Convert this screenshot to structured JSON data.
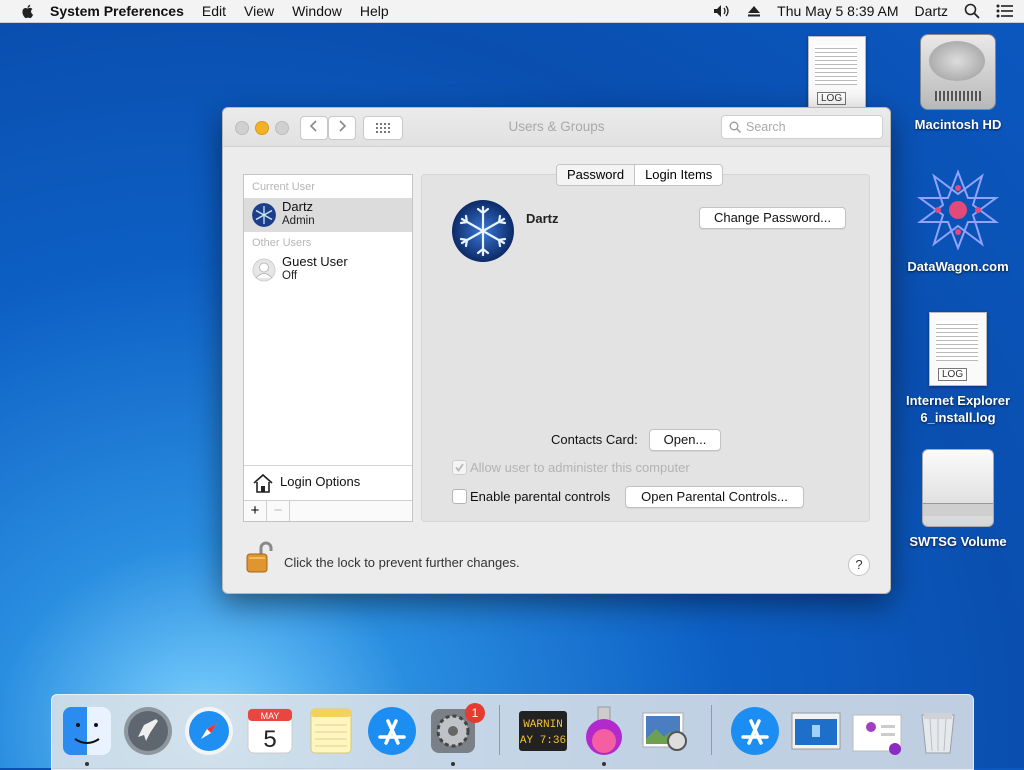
{
  "menubar": {
    "app_name": "System Preferences",
    "items": [
      "Edit",
      "View",
      "Window",
      "Help"
    ],
    "clock": "Thu May 5  8:39 AM",
    "user": "Dartz"
  },
  "desktop": {
    "icons": [
      {
        "label": "Macintosh HD"
      },
      {
        "label": "DataWagon.com"
      },
      {
        "label": "Internet Explorer 6_install.log"
      },
      {
        "label": "SWTSG Volume"
      }
    ],
    "log_tag": "LOG"
  },
  "window": {
    "title": "Users & Groups",
    "search_placeholder": "Search",
    "user_list": {
      "current_user_header": "Current User",
      "current_user": {
        "name": "Dartz",
        "role": "Admin"
      },
      "other_users_header": "Other Users",
      "other_users": [
        {
          "name": "Guest User",
          "status": "Off"
        }
      ],
      "login_options": "Login Options",
      "add_label": "+",
      "remove_label": "−"
    },
    "tabs": [
      "Password",
      "Login Items"
    ],
    "selected_tab": "Password",
    "user_name": "Dartz",
    "change_password": "Change Password...",
    "contacts_card_label": "Contacts Card:",
    "open_button": "Open...",
    "allow_admin_label": "Allow user to administer this computer",
    "allow_admin_checked": true,
    "parental_label": "Enable parental controls",
    "parental_checked": false,
    "open_parental": "Open Parental Controls...",
    "lock_text": "Click the lock to prevent further changes.",
    "help": "?"
  },
  "dock": {
    "calendar": {
      "month": "MAY",
      "day": "5"
    },
    "console_text": [
      "WARNIN",
      "AY 7:36"
    ],
    "prefs_badge": "1"
  }
}
